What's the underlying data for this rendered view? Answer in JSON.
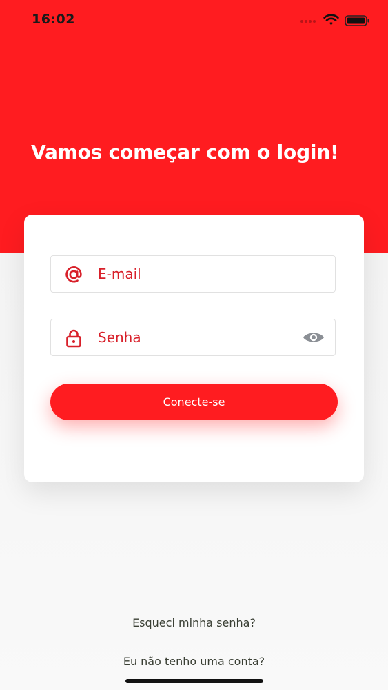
{
  "status_bar": {
    "time": "16:02",
    "icons": [
      "signal-dots-icon",
      "wifi-icon",
      "battery-icon"
    ]
  },
  "header": {
    "title": "Vamos começar com o login!"
  },
  "form": {
    "email": {
      "placeholder": "E-mail",
      "value": "",
      "icon": "at-sign-icon"
    },
    "password": {
      "placeholder": "Senha",
      "value": "",
      "icon": "lock-icon",
      "toggle_icon": "eye-icon"
    },
    "submit_label": "Conecte-se"
  },
  "links": {
    "forgot_password": "Esqueci minha senha?",
    "no_account": "Eu não tenho uma conta?"
  },
  "colors": {
    "brand_red": "#ff1c20",
    "field_text": "#d8202a",
    "link_text": "#3a3f34",
    "background": "#f6f6f6"
  }
}
